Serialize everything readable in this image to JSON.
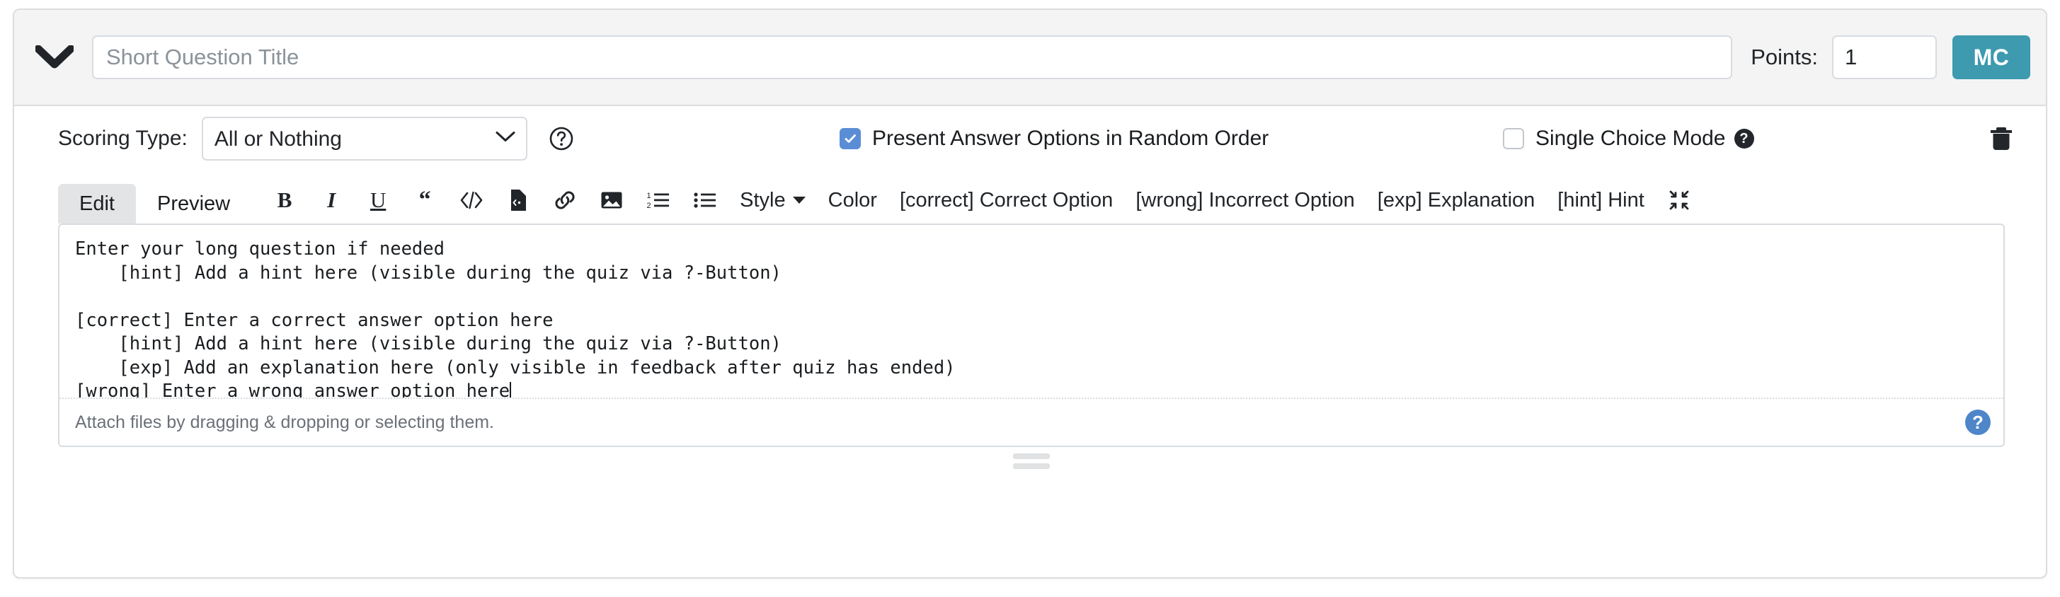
{
  "header": {
    "collapse_icon": "chevron-down-icon",
    "title_value": "",
    "title_placeholder": "Short Question Title",
    "points_label": "Points:",
    "points_value": "1",
    "type_badge": "MC",
    "badge_color": "#3d9aaf"
  },
  "options": {
    "scoring_type_label": "Scoring Type:",
    "scoring_type_value": "All or Nothing",
    "scoring_type_options": [
      "All or Nothing"
    ],
    "scoring_help_icon": "question-circle-icon",
    "random_order": {
      "label": "Present Answer Options in Random Order",
      "checked": true,
      "check_color": "#5b8dd6"
    },
    "single_choice": {
      "label": "Single Choice Mode",
      "checked": false,
      "help_icon_glyph": "?"
    },
    "delete_icon": "trash-icon"
  },
  "editor": {
    "tabs": [
      {
        "label": "Edit",
        "active": true
      },
      {
        "label": "Preview",
        "active": false
      }
    ],
    "tools": [
      {
        "name": "bold",
        "glyph": "B"
      },
      {
        "name": "italic",
        "glyph": "I"
      },
      {
        "name": "underline",
        "glyph": "U"
      },
      {
        "name": "blockquote",
        "glyph": "“"
      },
      {
        "name": "inline-code",
        "glyph": "</>"
      },
      {
        "name": "code-file",
        "glyph": "svg"
      },
      {
        "name": "link",
        "glyph": "svg"
      },
      {
        "name": "image",
        "glyph": "svg"
      },
      {
        "name": "ordered-list",
        "glyph": "svg"
      },
      {
        "name": "unordered-list",
        "glyph": "svg"
      }
    ],
    "style_label": "Style",
    "color_label": "Color",
    "macros": [
      "[correct] Correct Option",
      "[wrong] Incorrect Option",
      "[exp] Explanation",
      "[hint] Hint"
    ],
    "compress_icon": "compress-arrows-icon",
    "content": "Enter your long question if needed\n    [hint] Add a hint here (visible during the quiz via ?-Button)\n\n[correct] Enter a correct answer option here\n    [hint] Add a hint here (visible during the quiz via ?-Button)\n    [exp] Add an explanation here (only visible in feedback after quiz has ended)\n[wrong] Enter a wrong answer option here",
    "attach_hint": "Attach files by dragging & dropping or selecting them.",
    "footer_help_glyph": "?",
    "footer_help_color": "#4e86c9"
  }
}
